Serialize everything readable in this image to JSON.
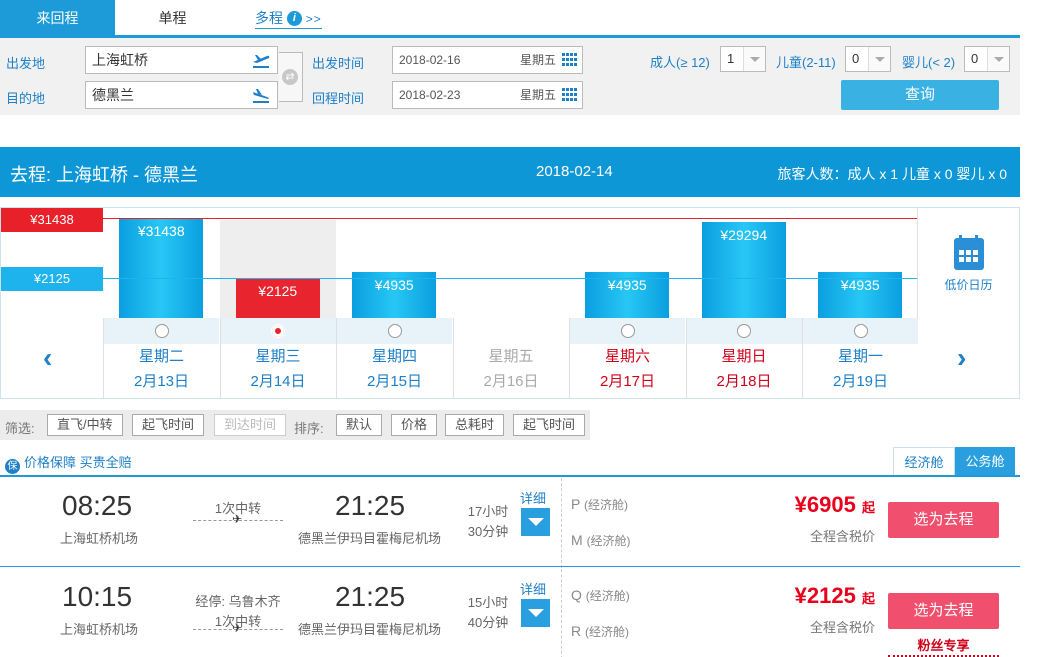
{
  "trip_tabs": {
    "round": "来回程",
    "oneway": "单程",
    "multi": "多程",
    "info_icon": "i",
    "more": ">>"
  },
  "search": {
    "from_label": "出发地",
    "to_label": "目的地",
    "from_value": "上海虹桥",
    "to_value": "德黑兰",
    "depart_label": "出发时间",
    "return_label": "回程时间",
    "depart_date": "2018-02-16",
    "depart_weekday": "星期五",
    "return_date": "2018-02-23",
    "return_weekday": "星期五",
    "adult_label": "成人(≥ 12)",
    "adult_value": "1",
    "child_label": "儿童(2-11)",
    "child_value": "0",
    "infant_label": "婴儿(< 2)",
    "infant_value": "0",
    "query_label": "查询"
  },
  "route_bar": {
    "title": "去程:  上海虹桥 - 德黑兰",
    "date": "2018-02-14",
    "pax": "旅客人数：成人 x 1   儿童 x 0   婴儿 x 0"
  },
  "price_chart": {
    "max_label": "¥31438",
    "min_label": "¥2125",
    "calendar_label": "低价日历",
    "prev_icon": "‹",
    "next_icon": "›"
  },
  "chart_data": {
    "type": "bar",
    "categories": [
      "2月13日",
      "2月14日",
      "2月15日",
      "2月16日",
      "2月17日",
      "2月18日",
      "2月19日"
    ],
    "values": [
      31438,
      2125,
      4935,
      null,
      4935,
      29294,
      4935
    ],
    "value_labels": [
      "¥31438",
      "¥2125",
      "¥4935",
      "",
      "¥4935",
      "¥29294",
      "¥4935"
    ],
    "weekdays": [
      "星期二",
      "星期三",
      "星期四",
      "星期五",
      "星期六",
      "星期日",
      "星期一"
    ],
    "selected_index": 1,
    "disabled_index": 3,
    "weekend_indices": [
      4,
      5
    ],
    "reference_lines": {
      "max": 31438,
      "min": 2125
    }
  },
  "filters": {
    "filter_label": "筛选:",
    "direct": "直飞/中转",
    "dep_time": "起飞时间",
    "arr_time": "到达时间",
    "sort_label": "排序:",
    "default": "默认",
    "price": "价格",
    "duration": "总耗时",
    "takeoff": "起飞时间"
  },
  "guarantee": {
    "badge": "保",
    "text": "价格保障 买贵全赔"
  },
  "cabin_tabs": {
    "economy": "经济舱",
    "business": "公务舱"
  },
  "flights": [
    {
      "dep_time": "08:25",
      "dep_airport": "上海虹桥机场",
      "stop_line1": "",
      "stop_line2": "1次中转",
      "arr_time": "21:25",
      "arr_airport": "德黑兰伊玛目霍梅尼机场",
      "dur_h": "17小时",
      "dur_m": "30分钟",
      "detail": "详细",
      "cabin1_code": "P",
      "cabin1_name": "(经济舱)",
      "cabin2_code": "M",
      "cabin2_name": "(经济舱)",
      "price": "¥6905",
      "price_suffix": "起",
      "tax_note": "全程含税价",
      "select": "选为去程",
      "fan": ""
    },
    {
      "dep_time": "10:15",
      "dep_airport": "上海虹桥机场",
      "stop_line1": "经停: 乌鲁木齐",
      "stop_line2": "1次中转",
      "arr_time": "21:25",
      "arr_airport": "德黑兰伊玛目霍梅尼机场",
      "dur_h": "15小时",
      "dur_m": "40分钟",
      "detail": "详细",
      "cabin1_code": "Q",
      "cabin1_name": "(经济舱)",
      "cabin2_code": "R",
      "cabin2_name": "(经济舱)",
      "price": "¥2125",
      "price_suffix": "起",
      "tax_note": "全程含税价",
      "select": "选为去程",
      "fan": "粉丝专享"
    }
  ],
  "colors": {
    "primary": "#1d9bd8",
    "accent_red": "#e8242e",
    "select_button": "#f0506e"
  }
}
